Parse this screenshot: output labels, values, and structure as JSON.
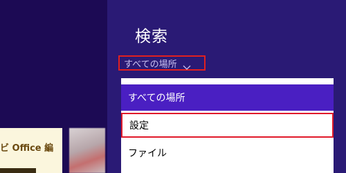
{
  "start_screen": {
    "office_tile_text": "ビ Office 編"
  },
  "search_pane": {
    "title": "検索",
    "scope": {
      "selected": "すべての場所",
      "icon": "chevron-down-icon"
    },
    "dropdown": {
      "items": [
        {
          "label": "すべての場所",
          "state": "selected"
        },
        {
          "label": "設定",
          "state": "highlighted"
        },
        {
          "label": "ファイル",
          "state": "normal"
        }
      ]
    }
  },
  "colors": {
    "pane_background": "#2a1a75",
    "selected_item": "#4a1fc2",
    "highlight_border": "#e01a2a"
  }
}
